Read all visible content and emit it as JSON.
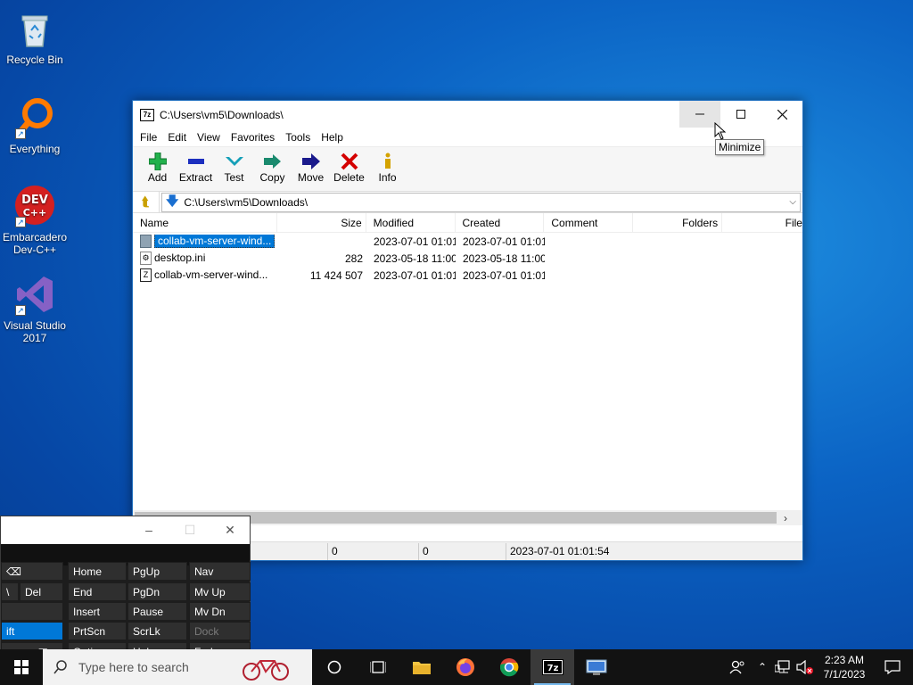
{
  "desktop": {
    "icons": [
      {
        "label": "Recycle Bin"
      },
      {
        "label": "Everything"
      },
      {
        "label": "Embarcadero Dev-C++"
      },
      {
        "label": "Visual Studio 2017"
      }
    ]
  },
  "window": {
    "title": "C:\\Users\\vm5\\Downloads\\",
    "app_icon": "7z",
    "menu": [
      "File",
      "Edit",
      "View",
      "Favorites",
      "Tools",
      "Help"
    ],
    "toolbar": [
      {
        "label": "Add",
        "icon": "plus-icon",
        "color": "#22b14c"
      },
      {
        "label": "Extract",
        "icon": "minus-icon",
        "color": "#1c2fbf"
      },
      {
        "label": "Test",
        "icon": "check-icon",
        "color": "#16a0b8"
      },
      {
        "label": "Copy",
        "icon": "double-arrow-icon",
        "color": "#1a8a6e"
      },
      {
        "label": "Move",
        "icon": "arrow-right-icon",
        "color": "#1a1a8c"
      },
      {
        "label": "Delete",
        "icon": "x-icon",
        "color": "#d40000"
      },
      {
        "label": "Info",
        "icon": "info-icon",
        "color": "#d4a300"
      }
    ],
    "address": "C:\\Users\\vm5\\Downloads\\",
    "columns": [
      "Name",
      "Size",
      "Modified",
      "Created",
      "Comment",
      "Folders",
      "File"
    ],
    "rows": [
      {
        "name": "collab-vm-server-wind...",
        "size": "",
        "modified": "2023-07-01 01:01",
        "created": "2023-07-01 01:01",
        "selected": true,
        "icon": "folder-icon"
      },
      {
        "name": "desktop.ini",
        "size": "282",
        "modified": "2023-05-18 11:00",
        "created": "2023-05-18 11:00",
        "selected": false,
        "icon": "settings-file-icon"
      },
      {
        "name": "collab-vm-server-wind...",
        "size": "11 424 507",
        "modified": "2023-07-01 01:01",
        "created": "2023-07-01 01:01",
        "selected": false,
        "icon": "zip-file-icon"
      }
    ],
    "status": [
      "0",
      "0",
      "2023-07-01 01:01:54"
    ],
    "tooltip": "Minimize"
  },
  "osk": {
    "keys": [
      "Home",
      "PgUp",
      "Nav",
      "Del",
      "End",
      "PgDn",
      "Mv Up",
      "Insert",
      "Pause",
      "Mv Dn",
      "ift",
      "PrtScn",
      "ScrLk",
      "Dock",
      "Options",
      "Help",
      "Fade"
    ]
  },
  "taskbar": {
    "search_placeholder": "Type here to search",
    "time": "2:23 AM",
    "date": "7/1/2023"
  }
}
